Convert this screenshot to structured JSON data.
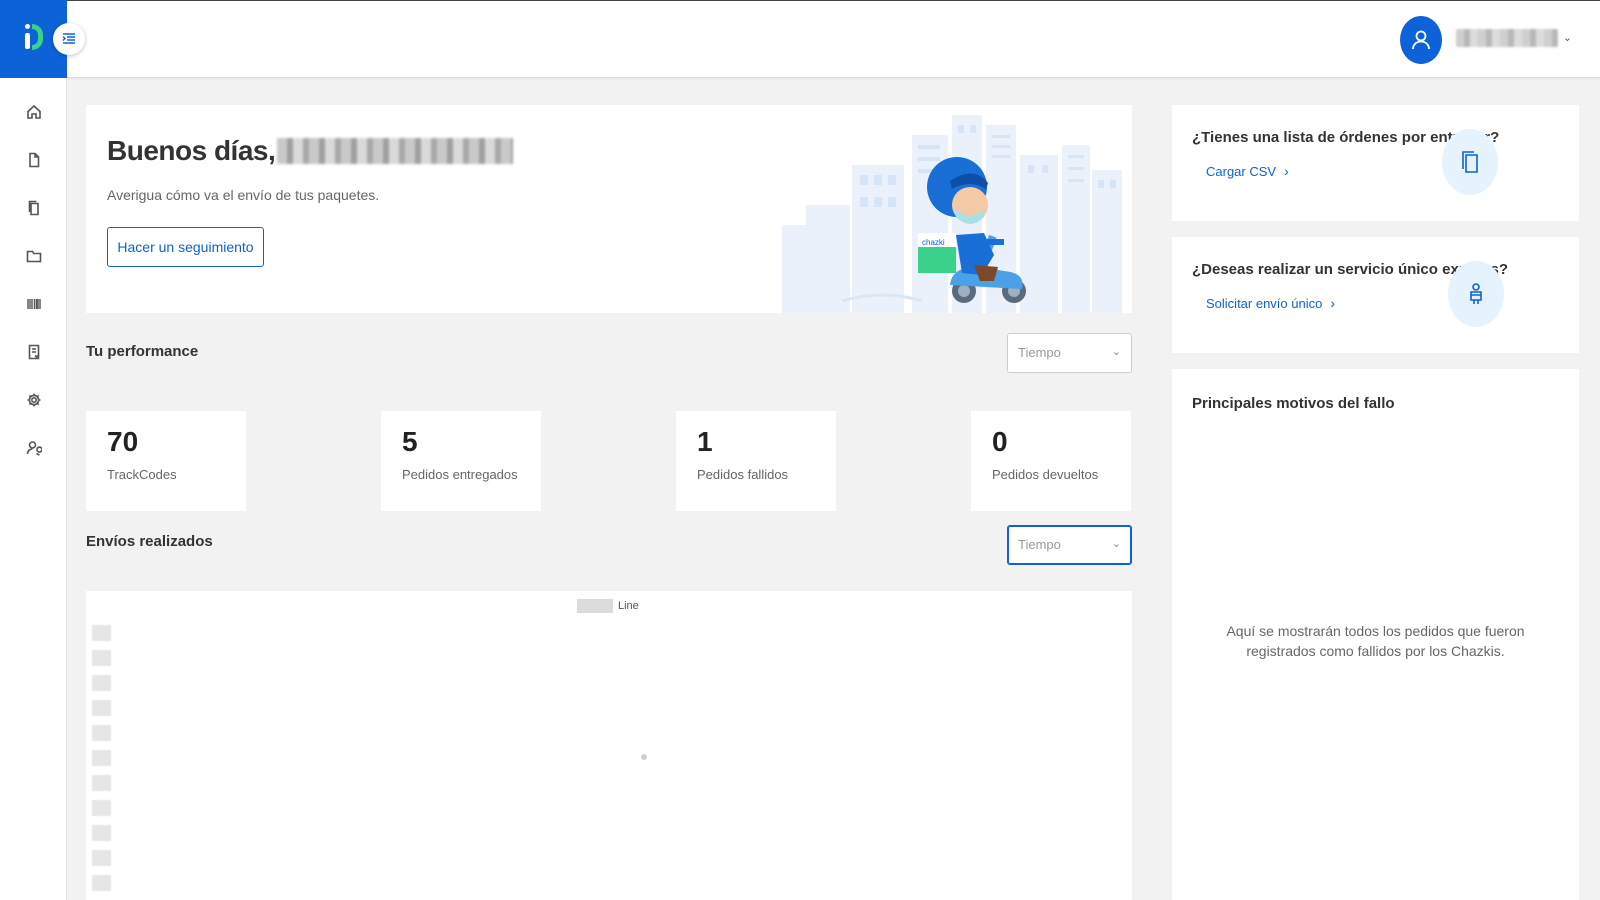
{
  "sidebar": {
    "toggle_icon": "menu-indent-icon",
    "items": [
      {
        "name": "home",
        "icon": "home-icon"
      },
      {
        "name": "document",
        "icon": "document-icon"
      },
      {
        "name": "copy",
        "icon": "copy-icon"
      },
      {
        "name": "folder",
        "icon": "folder-icon"
      },
      {
        "name": "barcode",
        "icon": "barcode-icon"
      },
      {
        "name": "invoice",
        "icon": "invoice-icon"
      },
      {
        "name": "settings",
        "icon": "gear-icon"
      },
      {
        "name": "user-search",
        "icon": "user-search-icon"
      }
    ]
  },
  "header": {
    "avatar_icon": "user-icon",
    "chevron": "⌄"
  },
  "welcome": {
    "greeting": "Buenos días,",
    "subtitle": "Averigua cómo va el envío de tus paquetes.",
    "track_button": "Hacer un seguimiento",
    "illustration_label": "chazki"
  },
  "performance": {
    "title": "Tu performance",
    "filter_placeholder": "Tiempo",
    "stats": [
      {
        "value": "70",
        "label": "TrackCodes"
      },
      {
        "value": "5",
        "label": "Pedidos entregados"
      },
      {
        "value": "1",
        "label": "Pedidos fallidos"
      },
      {
        "value": "0",
        "label": "Pedidos devueltos"
      }
    ]
  },
  "shipments": {
    "title": "Envíos realizados",
    "filter_placeholder": "Tiempo",
    "legend_label": "Line"
  },
  "promos": [
    {
      "question": "¿Tienes una lista de órdenes por entregar?",
      "link": "Cargar CSV",
      "icon": "copy-icon"
    },
    {
      "question": "¿Deseas realizar un servicio único express?",
      "link": "Solicitar envío único",
      "icon": "courier-icon"
    }
  ],
  "failures": {
    "title": "Principales motivos del fallo",
    "message": "Aquí se mostrarán todos los pedidos que fueron registrados como fallidos por los Chazkis."
  },
  "colors": {
    "primary": "#0d62d8",
    "accent_green": "#3cd18a",
    "background": "#f2f2f2"
  }
}
